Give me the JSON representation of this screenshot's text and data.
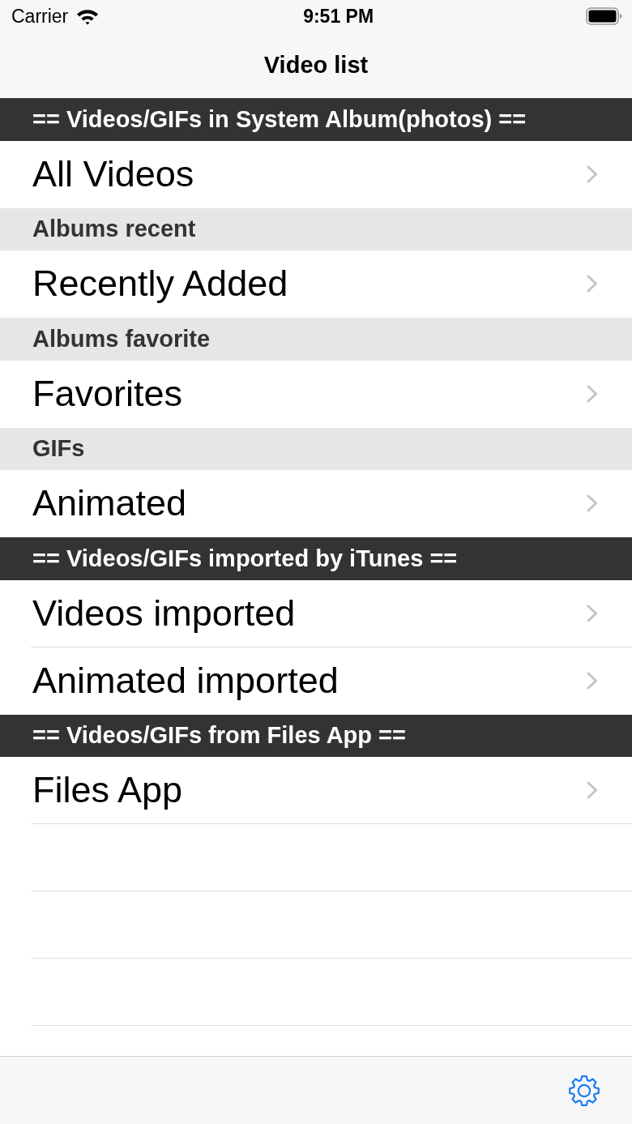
{
  "status_bar": {
    "carrier": "Carrier",
    "time": "9:51 PM"
  },
  "nav_bar": {
    "title": "Video list"
  },
  "sections": [
    {
      "kind": "banner",
      "header": "== Videos/GIFs in System Album(photos) ==",
      "rows": [
        "All Videos"
      ]
    },
    {
      "kind": "subheader",
      "header": "Albums recent",
      "rows": [
        "Recently Added"
      ]
    },
    {
      "kind": "subheader",
      "header": "Albums favorite",
      "rows": [
        "Favorites"
      ]
    },
    {
      "kind": "subheader",
      "header": "GIFs",
      "rows": [
        "Animated"
      ]
    },
    {
      "kind": "banner",
      "header": "== Videos/GIFs imported by iTunes ==",
      "rows": [
        "Videos imported",
        "Animated imported"
      ]
    },
    {
      "kind": "banner",
      "header": "== Videos/GIFs from Files App ==",
      "rows": [
        "Files App"
      ]
    }
  ]
}
